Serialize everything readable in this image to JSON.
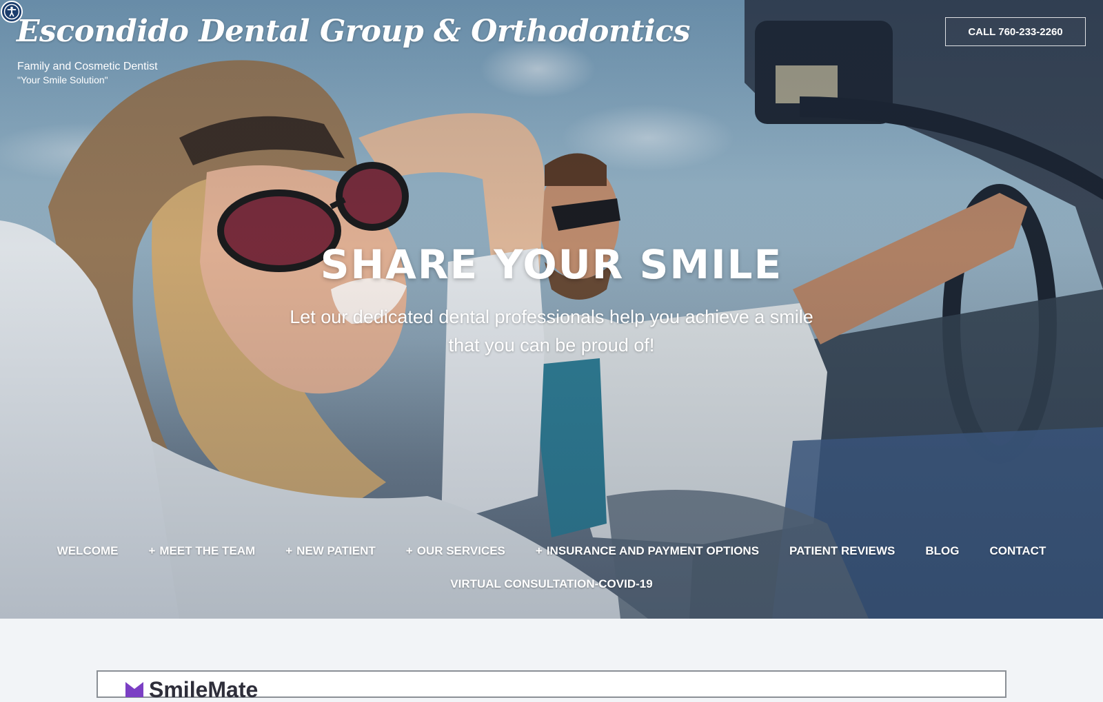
{
  "header": {
    "site_title": "Escondido Dental Group & Orthodontics",
    "tagline_1": "Family and Cosmetic Dentist",
    "tagline_2": "\"Your Smile Solution\"",
    "call_button": "CALL 760-233-2260"
  },
  "hero": {
    "headline": "SHARE YOUR SMILE",
    "subhead": "Let our dedicated dental professionals help you achieve a smile that you can be proud of!"
  },
  "nav": {
    "row1": [
      {
        "label": "WELCOME",
        "has_submenu": false
      },
      {
        "label": "MEET THE TEAM",
        "has_submenu": true
      },
      {
        "label": "NEW PATIENT",
        "has_submenu": true
      },
      {
        "label": "OUR SERVICES",
        "has_submenu": true
      },
      {
        "label": "INSURANCE AND PAYMENT OPTIONS",
        "has_submenu": true
      },
      {
        "label": "PATIENT REVIEWS",
        "has_submenu": false
      },
      {
        "label": "BLOG",
        "has_submenu": false
      },
      {
        "label": "CONTACT",
        "has_submenu": false
      }
    ],
    "row2": [
      {
        "label": "VIRTUAL CONSULTATION-COVID-19",
        "has_submenu": false
      }
    ],
    "submenu_marker": "+"
  },
  "content_card": {
    "logo_text": "SmileMate"
  },
  "icons": {
    "accessibility": "accessibility-icon",
    "logo_mark": "smilemate-logo-icon"
  },
  "colors": {
    "accessibility_bg": "#1b3d6d",
    "page_bg": "#f2f4f7",
    "logo_purple": "#7b3fc4"
  }
}
